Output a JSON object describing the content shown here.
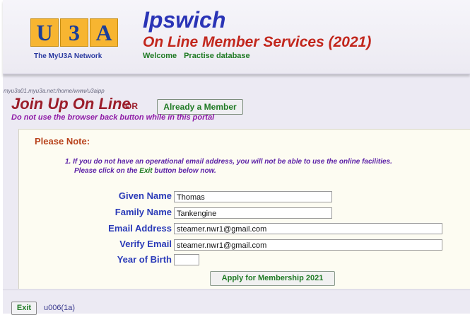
{
  "logo": {
    "letters": [
      "U",
      "3",
      "A"
    ],
    "tagline": "The MyU3A Network",
    "box_color": "#f7b531",
    "letter_color": "#1b3e99"
  },
  "header": {
    "org_name": "Ipswich",
    "service_title": "On Line Member Services (2021)",
    "welcome": "Welcome",
    "database": "Practise database"
  },
  "join": {
    "path": "myu3a01.myu3a.net:/home/www/u3aipp",
    "title": "Join Up On Line",
    "or": "OR",
    "member_button": "Already a Member",
    "warning": "Do not use the browser back button while in this portal"
  },
  "note": {
    "heading": "Please Note:",
    "line1": "1. If you do not have an operational email address, you will not be able to use the online facilities.",
    "line2_before": "Please click on the",
    "line2_exit": "Exit",
    "line2_after": "button below now."
  },
  "form": {
    "given_name_label": "Given Name",
    "given_name_value": "Thomas",
    "family_name_label": "Family Name",
    "family_name_value": "Tankengine",
    "email_label": "Email Address",
    "email_value": "steamer.nwr1@gmail.com",
    "verify_label": "Verify Email",
    "verify_value": "steamer.nwr1@gmail.com",
    "yob_label": "Year of Birth",
    "yob_value": "",
    "apply_button": "Apply for Membership 2021"
  },
  "footer": {
    "exit_button": "Exit",
    "code": "u006(1a)"
  },
  "colors": {
    "title_blue": "#2a34b6",
    "title_red": "#c2271d",
    "green": "#1f7a24",
    "purple": "#8e1aa6"
  }
}
